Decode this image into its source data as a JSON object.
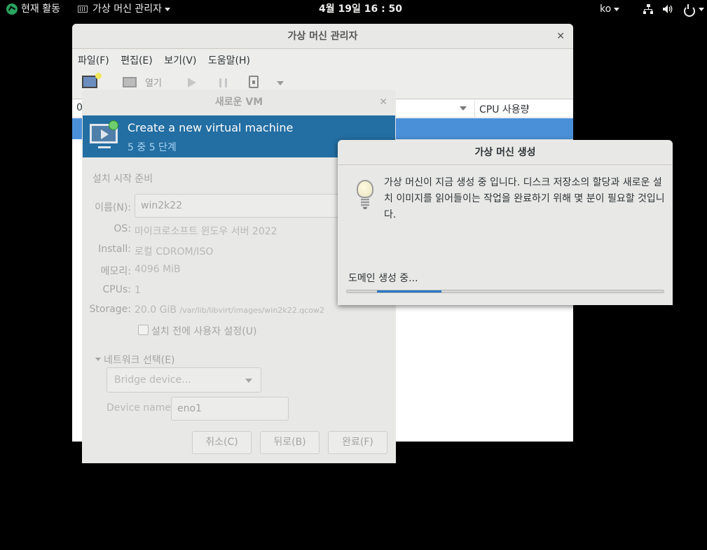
{
  "topbar": {
    "activities": "현재 활동",
    "app_menu": "가상 머신 관리자",
    "clock": "4월 19일  16 : 50",
    "lang": "ko"
  },
  "main_window": {
    "title": "가상 머신 관리자",
    "menus": [
      "파일(F)",
      "편집(E)",
      "보기(V)",
      "도움말(H)"
    ],
    "toolbar": {
      "open_label": "열기"
    },
    "list": {
      "col0": "0",
      "cpu_header": "CPU 사용량"
    }
  },
  "new_vm": {
    "title": "새로운 VM",
    "banner_title": "Create a new virtual machine",
    "banner_step": "5 중 5 단계",
    "section": "설치 시작 준비",
    "name_label": "이름(N):",
    "name_value": "win2k22",
    "os_label": "OS:",
    "os_value": "마이크로소프트 윈도우 서버 2022",
    "install_label": "Install:",
    "install_value": "로컬 CDROM/ISO",
    "memory_label": "메모리:",
    "memory_value": "4096 MiB",
    "cpus_label": "CPUs:",
    "cpus_value": "1",
    "storage_label": "Storage:",
    "storage_size": "20.0 GiB",
    "storage_path": "/var/lib/libvirt/images/win2k22.qcow2",
    "customize_label": "설치 전에 사용자 설정(U)",
    "network_label": "네트워크 선택(E)",
    "network_combo": "Bridge device...",
    "device_name_label": "Device name:",
    "device_name_value": "eno1",
    "btn_cancel": "취소(C)",
    "btn_back": "뒤로(B)",
    "btn_finish": "완료(F)"
  },
  "progress": {
    "title": "가상 머신 생성",
    "message": "가상 머신이 지금 생성 중 입니다. 디스크 저장소의 할당과 새로운 설치 이미지를 읽어들이는 작업을 완료하기 위해 몇 분이 필요할 것입니다.",
    "status": "도메인 생성 중..."
  },
  "colors": {
    "accent": "#4a90d9",
    "banner": "#236ea2",
    "progress_fill": "#2a76c6"
  }
}
